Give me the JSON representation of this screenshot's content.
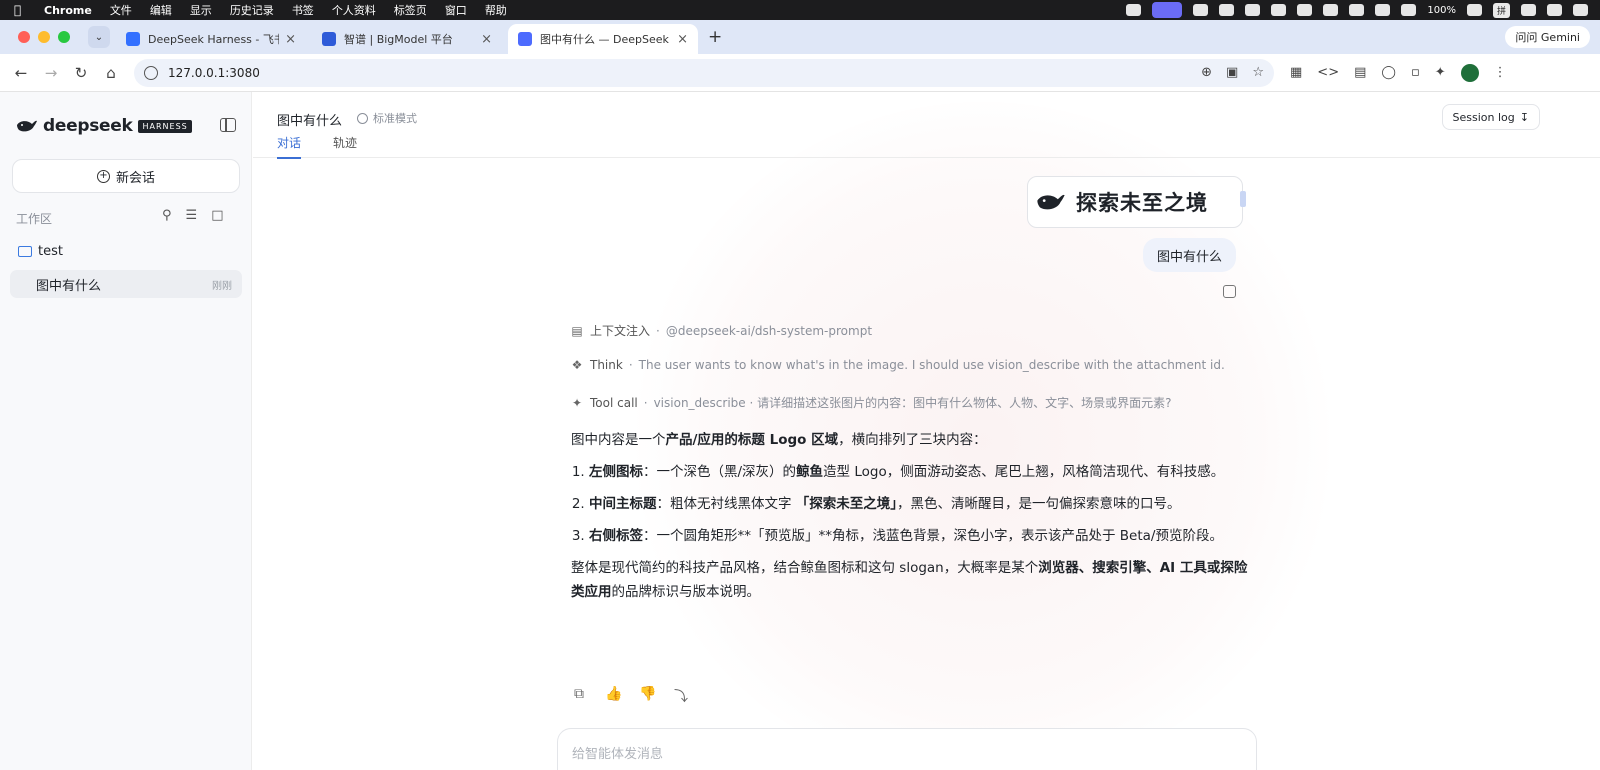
{
  "menubar": {
    "app": "Chrome",
    "items": [
      "文件",
      "编辑",
      "显示",
      "历史记录",
      "书签",
      "个人资料",
      "标签页",
      "窗口",
      "帮助"
    ],
    "battery": "100%",
    "ime": "拼"
  },
  "browser": {
    "tabs": [
      {
        "label": "DeepSeek Harness - 飞书云文",
        "color": "#3370ff"
      },
      {
        "label": "智谱 | BigModel 平台",
        "color": "#2e5bd8"
      },
      {
        "label": "图中有什么 — DeepSeek Harn",
        "color": "#4d6bfe"
      }
    ],
    "gemini_label": "问问 Gemini",
    "url": "127.0.0.1:3080"
  },
  "sidebar": {
    "brand": "deepseek",
    "badge": "HARNESS",
    "new_chat": "新会话",
    "workspace_label": "工作区",
    "folder": "test",
    "sessions": [
      {
        "title": "图中有什么",
        "time": "刚刚"
      }
    ]
  },
  "main": {
    "title": "图中有什么",
    "mode": "标准模式",
    "tabs": [
      "对话",
      "轨迹"
    ],
    "session_log": "Session log",
    "image_slogan": "探索未至之境",
    "user_message": "图中有什么",
    "trace": [
      {
        "icon": "context-icon",
        "label": "上下文注入",
        "detail": "@deepseek-ai/dsh-system-prompt"
      },
      {
        "icon": "think-icon",
        "label": "Think",
        "detail": "The user wants to know what's in the image. I should use vision_describe with the attachment id."
      },
      {
        "icon": "tool-icon",
        "label": "Tool call",
        "detail": "vision_describe · 请详细描述这张图片的内容：图中有什么物体、人物、文字、场景或界面元素?"
      }
    ],
    "answer": {
      "intro_pre": "图中内容是一个",
      "intro_bold": "产品/应用的标题 Logo 区域",
      "intro_post": "，横向排列了三块内容：",
      "items": [
        {
          "bold": "左侧图标",
          "pre": "：一个深色（黑/深灰）的",
          "bold2": "鲸鱼",
          "post": "造型 Logo，侧面游动姿态、尾巴上翘，风格简洁现代、有科技感。"
        },
        {
          "bold": "中间主标题",
          "pre": "：粗体无衬线黑体文字 ",
          "bold2": "「探索未至之境」",
          "post": "，黑色、清晰醒目，是一句偏探索意味的口号。"
        },
        {
          "bold": "右侧标签",
          "pre": "：一个圆角矩形**「预览版」**角标，浅蓝色背景，深色小字，表示该产品处于 Beta/预览阶段。",
          "bold2": "",
          "post": ""
        }
      ],
      "summary_pre": "整体是现代简约的科技产品风格，结合鲸鱼图标和这句 slogan，大概率是某个",
      "summary_bold": "浏览器、搜索引擎、AI 工具或探险类应用",
      "summary_post": "的品牌标识与版本说明。"
    },
    "composer_placeholder": "给智能体发消息"
  }
}
